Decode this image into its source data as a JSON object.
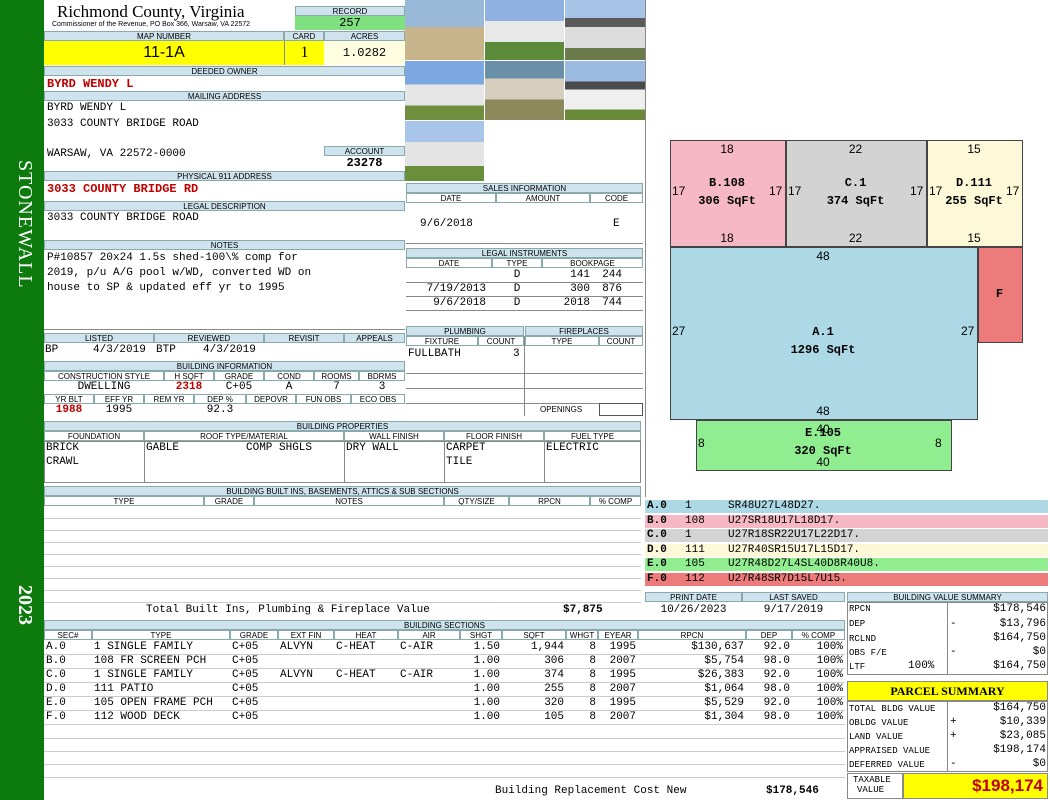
{
  "sidebar": {
    "district": "STONEWALL",
    "year": "2023"
  },
  "header": {
    "county": "Richmond County, Virginia",
    "commissioner": "Commissioner of the Revenue, PO Box 366, Warsaw, VA 22572",
    "record_label": "RECORD",
    "record": "257",
    "map_label": "MAP NUMBER",
    "map": "11-1A",
    "card_label": "CARD",
    "card": "1",
    "acres_label": "ACRES",
    "acres": "1.0282"
  },
  "owner": {
    "deeded_label": "DEEDED OWNER",
    "deeded": "BYRD WENDY L",
    "mailing_label": "MAILING ADDRESS",
    "mail1": "BYRD WENDY L",
    "mail2": "3033 COUNTY BRIDGE ROAD",
    "mail3": "WARSAW, VA 22572-0000",
    "account_label": "ACCOUNT",
    "account": "23278",
    "physical_label": "PHYSICAL 911 ADDRESS",
    "physical": "3033 COUNTY BRIDGE RD",
    "legal_label": "LEGAL DESCRIPTION",
    "legal": "3033 COUNTY BRIDGE ROAD"
  },
  "notes": {
    "label": "NOTES",
    "line1": "P#10857 20x24 1.5s shed-100\\% comp for",
    "line2": "2019, p/u A/G pool w/WD, converted WD on",
    "line3": "house to SP & updated eff yr to 1995"
  },
  "review": {
    "listed_label": "LISTED",
    "reviewed_label": "REVIEWED",
    "revisit_label": "REVISIT",
    "appeals_label": "APPEALS",
    "listed_by": "BP",
    "listed_date": "4/3/2019",
    "reviewed_by": "BTP",
    "reviewed_date": "4/3/2019"
  },
  "building_info": {
    "label": "BUILDING INFORMATION",
    "h_style": "CONSTRUCTION STYLE",
    "h_sqft": "H SQFT",
    "h_grade": "GRADE",
    "h_cond": "COND",
    "h_rooms": "ROOMS",
    "h_bdrms": "BDRMS",
    "style": "DWELLING",
    "sqft": "2318",
    "grade": "C+05",
    "cond": "A",
    "rooms": "7",
    "bdrms": "3",
    "h_yrblt": "YR BLT",
    "h_effyr": "EFF YR",
    "h_remyr": "REM YR",
    "h_dep": "DEP %",
    "h_depovr": "DEPOVR",
    "h_funobs": "FUN OBS",
    "h_ecoobs": "ECO OBS",
    "yrblt": "1988",
    "effyr": "1995",
    "dep": "92.3"
  },
  "sales": {
    "label": "SALES INFORMATION",
    "h_date": "DATE",
    "h_amount": "AMOUNT",
    "h_code": "CODE",
    "date": "9/6/2018",
    "code": "E"
  },
  "legal_instruments": {
    "label": "LEGAL INSTRUMENTS",
    "h_date": "DATE",
    "h_type": "TYPE",
    "h_book": "BOOKPAGE",
    "rows": [
      {
        "date": "",
        "type": "D",
        "book": "141",
        "page": "244"
      },
      {
        "date": "7/19/2013",
        "type": "D",
        "book": "300",
        "page": "876"
      },
      {
        "date": "9/6/2018",
        "type": "D",
        "book": "2018",
        "page": "744"
      }
    ]
  },
  "plumbing": {
    "label": "PLUMBING",
    "h_fixture": "FIXTURE",
    "h_count": "COUNT",
    "fixture": "FULLBATH",
    "count": "3"
  },
  "fireplaces": {
    "label": "FIREPLACES",
    "h_type": "TYPE",
    "h_count": "COUNT",
    "openings": "OPENINGS"
  },
  "building_properties": {
    "label": "BUILDING PROPERTIES",
    "h_foundation": "FOUNDATION",
    "h_roof": "ROOF TYPE/MATERIAL",
    "h_wall": "WALL FINISH",
    "h_floor": "FLOOR FINISH",
    "h_fuel": "FUEL TYPE",
    "foundation1": "BRICK",
    "foundation2": "CRAWL",
    "roof_type": "GABLE",
    "roof_material": "COMP SHGLS",
    "wall": "DRY WALL",
    "floor1": "CARPET",
    "floor2": "TILE",
    "fuel": "ELECTRIC"
  },
  "built_ins": {
    "label": "BUILDING BUILT INS, BASEMENTS, ATTICS & SUB SECTIONS",
    "h_type": "TYPE",
    "h_grade": "GRADE",
    "h_notes": "NOTES",
    "h_qty": "QTY/SIZE",
    "h_rpcn": "RPCN",
    "h_comp": "% COMP",
    "total_label": "Total Built Ins, Plumbing & Fireplace Value",
    "total": "$7,875"
  },
  "sketch": {
    "sections": [
      {
        "id": "B.108",
        "area": "306 SqFt",
        "top": "18",
        "bottom": "18",
        "left": "17",
        "right": "17",
        "color": "#f5b8c4"
      },
      {
        "id": "C.1",
        "area": "374 SqFt",
        "top": "22",
        "bottom": "22",
        "left": "17",
        "right": "17",
        "color": "#d3d3d3"
      },
      {
        "id": "D.111",
        "area": "255 SqFt",
        "top": "15",
        "bottom": "15",
        "left": "17",
        "right": "17",
        "color": "#fcf8d8"
      },
      {
        "id": "A.1",
        "area": "1296 SqFt",
        "top": "48",
        "bottom": "48",
        "left": "27",
        "right": "27",
        "color": "#add8e6"
      },
      {
        "id": "F",
        "area": "",
        "color": "#ee7b7b"
      },
      {
        "id": "E.105",
        "area": "320 SqFt",
        "top": "40",
        "bottom": "40",
        "left": "8",
        "right": "8",
        "color": "#90ee90"
      }
    ]
  },
  "vectors": [
    {
      "code": "A.0",
      "num": "1",
      "vec": "SR48U27L48D27.",
      "color": "#add8e6"
    },
    {
      "code": "B.0",
      "num": "108",
      "vec": "U27SR18U17L18D17.",
      "color": "#f5b8c4"
    },
    {
      "code": "C.0",
      "num": "1",
      "vec": "U27R18SR22U17L22D17.",
      "color": "#d3d3d3"
    },
    {
      "code": "D.0",
      "num": "111",
      "vec": "U27R40SR15U17L15D17.",
      "color": "#fcf8d8"
    },
    {
      "code": "E.0",
      "num": "105",
      "vec": "U27R48D27L4SL40D8R40U8.",
      "color": "#90ee90"
    },
    {
      "code": "F.0",
      "num": "112",
      "vec": "U27R48SR7D15L7U15.",
      "color": "#ee7b7b"
    }
  ],
  "dates": {
    "print_label": "PRINT DATE",
    "saved_label": "LAST SAVED",
    "print": "10/26/2023",
    "saved": "9/17/2019"
  },
  "sections": {
    "label": "BUILDING SECTIONS",
    "headers": [
      "SEC#",
      "TYPE",
      "GRADE",
      "EXT FIN",
      "HEAT",
      "AIR",
      "SHGT",
      "SQFT",
      "WHGT",
      "EYEAR",
      "RPCN",
      "DEP",
      "% COMP"
    ],
    "rows": [
      [
        "A.0",
        "1 SINGLE FAMILY",
        "C+05",
        "ALVYN",
        "C-HEAT",
        "C-AIR",
        "1.50",
        "1,944",
        "8",
        "1995",
        "$130,637",
        "92.0",
        "100%"
      ],
      [
        "B.0",
        "108 FR SCREEN PCH",
        "C+05",
        "",
        "",
        "",
        "1.00",
        "306",
        "8",
        "2007",
        "$5,754",
        "98.0",
        "100%"
      ],
      [
        "C.0",
        "1 SINGLE FAMILY",
        "C+05",
        "ALVYN",
        "C-HEAT",
        "C-AIR",
        "1.00",
        "374",
        "8",
        "1995",
        "$26,383",
        "92.0",
        "100%"
      ],
      [
        "D.0",
        "111 PATIO",
        "C+05",
        "",
        "",
        "",
        "1.00",
        "255",
        "8",
        "2007",
        "$1,064",
        "98.0",
        "100%"
      ],
      [
        "E.0",
        "105 OPEN FRAME PCH",
        "C+05",
        "",
        "",
        "",
        "1.00",
        "320",
        "8",
        "1995",
        "$5,529",
        "92.0",
        "100%"
      ],
      [
        "F.0",
        "112 WOOD DECK",
        "C+05",
        "",
        "",
        "",
        "1.00",
        "105",
        "8",
        "2007",
        "$1,304",
        "98.0",
        "100%"
      ]
    ],
    "replacement_label": "Building Replacement Cost New",
    "replacement": "$178,546"
  },
  "value_summary": {
    "label": "BUILDING VALUE SUMMARY",
    "rpcn_label": "RPCN",
    "rpcn": "$178,546",
    "dep_label": "DEP",
    "dep_sign": "-",
    "dep": "$13,796",
    "rclnd_label": "RCLND",
    "rclnd": "$164,750",
    "obs_label": "OBS F/E",
    "obs_sign": "-",
    "obs": "$0",
    "ltf_label": "LTF",
    "ltf_pct": "100%",
    "ltf": "$164,750"
  },
  "parcel": {
    "title": "PARCEL SUMMARY",
    "bldg_label": "TOTAL BLDG VALUE",
    "bldg": "$164,750",
    "obldg_label": "OBLDG VALUE",
    "obldg_sign": "+",
    "obldg": "$10,339",
    "land_label": "LAND VALUE",
    "land_sign": "+",
    "land": "$23,085",
    "appraised_label": "APPRAISED VALUE",
    "appraised": "$198,174",
    "deferred_label": "DEFERRED VALUE",
    "deferred_sign": "-",
    "deferred": "$0",
    "taxable_label1": "TAXABLE",
    "taxable_label2": "VALUE",
    "taxable": "$198,174"
  }
}
